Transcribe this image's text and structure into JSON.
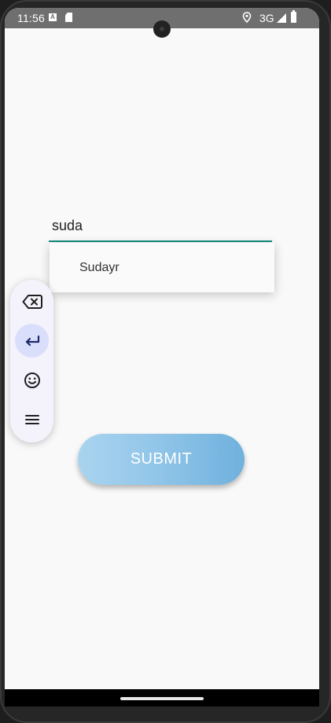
{
  "status_bar": {
    "time": "11:56",
    "a_icon_label": "A",
    "network": "3G",
    "icons": [
      "a-notification-icon",
      "sd-card-icon",
      "location-icon",
      "signal-icon",
      "battery-icon"
    ]
  },
  "form": {
    "input_value": "suda",
    "suggestions": [
      "Sudayr"
    ],
    "submit_label": "SUBMIT"
  },
  "keyboard_toolbar": {
    "buttons": [
      "backspace-icon",
      "enter-icon",
      "emoji-icon",
      "menu-icon"
    ],
    "active_button": "enter-icon"
  },
  "colors": {
    "input_underline": "#128c7e",
    "submit_gradient_start": "#a9d4ef",
    "submit_gradient_end": "#6fb1dd",
    "toolbar_active": "#d9dffb"
  }
}
